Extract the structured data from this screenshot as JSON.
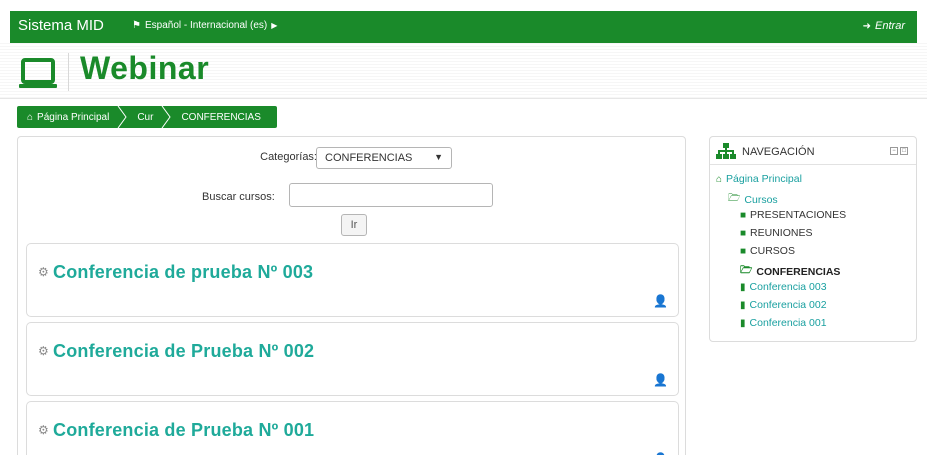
{
  "navbar": {
    "brand": "Sistema MID",
    "language": "Español - Internacional (es)",
    "login": "Entrar",
    "color": "#1a8a2a"
  },
  "header": {
    "title": "Webinar",
    "icon": "laptop-icon"
  },
  "breadcrumb": {
    "items": [
      "Página Principal",
      "Cur",
      "CONFERENCIAS"
    ]
  },
  "search": {
    "category_label": "Categorías:",
    "category_selected": "CONFERENCIAS",
    "search_label": "Buscar cursos:",
    "search_value": "",
    "go_label": "Ir"
  },
  "courses": [
    {
      "title": "Conferencia de prueba Nº 003"
    },
    {
      "title": "Conferencia de Prueba Nº 002"
    },
    {
      "title": "Conferencia de Prueba Nº 001"
    }
  ],
  "navigation": {
    "title": "NAVEGACIÓN",
    "tree": [
      {
        "label": "Página Principal",
        "icon": "home-icon"
      },
      {
        "label": "Cursos",
        "icon": "folder-open-icon"
      },
      {
        "label": "PRESENTACIONES",
        "icon": "folder-icon"
      },
      {
        "label": "REUNIONES",
        "icon": "folder-icon"
      },
      {
        "label": "CURSOS",
        "icon": "folder-icon"
      },
      {
        "label": "CONFERENCIAS",
        "icon": "folder-open-icon"
      },
      {
        "label": "Conferencia 003",
        "icon": "file-icon"
      },
      {
        "label": "Conferencia 002",
        "icon": "file-icon"
      },
      {
        "label": "Conferencia 001",
        "icon": "file-icon"
      }
    ]
  },
  "colors": {
    "primary": "#1a8a2a",
    "course_title": "#1faa9a",
    "link": "#1aa0a0"
  }
}
